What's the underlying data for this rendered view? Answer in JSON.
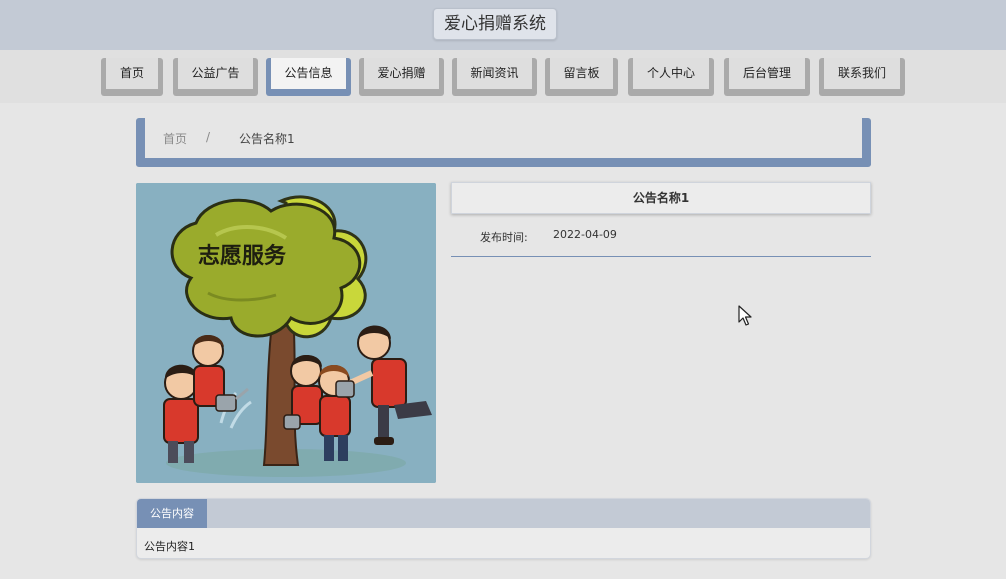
{
  "header": {
    "site_title": "爱心捐赠系统"
  },
  "nav": {
    "items": [
      {
        "label": "首页"
      },
      {
        "label": "公益广告"
      },
      {
        "label": "公告信息",
        "active": true
      },
      {
        "label": "爱心捐赠"
      },
      {
        "label": "新闻资讯"
      },
      {
        "label": "留言板"
      },
      {
        "label": "个人中心"
      },
      {
        "label": "后台管理"
      },
      {
        "label": "联系我们"
      }
    ]
  },
  "breadcrumb": {
    "home": "首页",
    "separator": "/",
    "current": "公告名称1"
  },
  "notice": {
    "title": "公告名称1",
    "publish_label": "发布时间:",
    "publish_date": "2022-04-09",
    "image_text": "志愿服务"
  },
  "content": {
    "tab_label": "公告内容",
    "text": "公告内容1"
  },
  "colors": {
    "accent": "#7790b5",
    "header_bg": "#c3cad5",
    "page_bg": "#e6e6e6",
    "nav_tab": "#aaaaaa"
  }
}
